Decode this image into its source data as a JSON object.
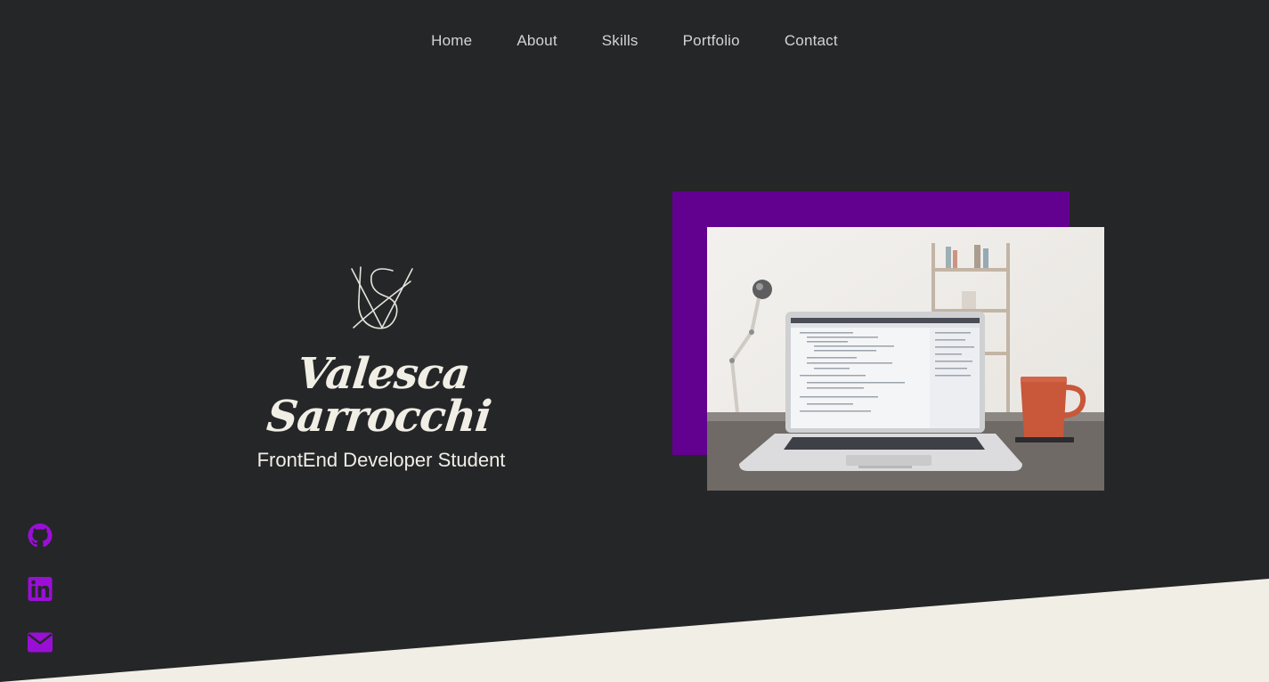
{
  "nav": {
    "items": [
      {
        "label": "Home"
      },
      {
        "label": "About"
      },
      {
        "label": "Skills"
      },
      {
        "label": "Portfolio"
      },
      {
        "label": "Contact"
      }
    ]
  },
  "hero": {
    "logo_letters": "VS",
    "name": "Valesca Sarrocchi",
    "role": "FrontEnd Developer Student"
  },
  "image": {
    "subject": "laptop-on-desk-with-code"
  },
  "socials": {
    "items": [
      {
        "icon": "github-icon"
      },
      {
        "icon": "linkedin-icon"
      },
      {
        "icon": "envelope-icon"
      }
    ]
  },
  "colors": {
    "background": "#252628",
    "accent": "#620090",
    "icon_accent": "#9a0fd6",
    "light": "#f1eee6",
    "nav_text": "#d4d4d4"
  }
}
